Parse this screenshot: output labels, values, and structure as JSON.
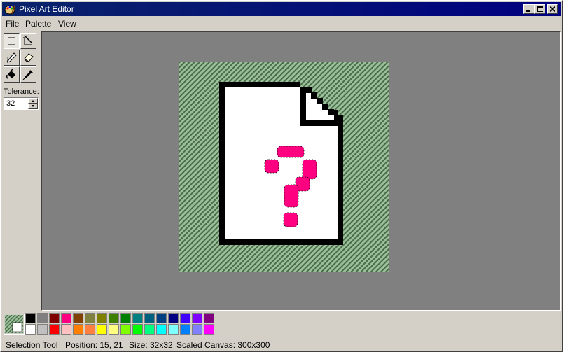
{
  "window": {
    "title": "Pixel Art Editor"
  },
  "menu": [
    "File",
    "Palette",
    "View"
  ],
  "tools": [
    {
      "name": "selection-tool",
      "icon": "selection-rect-icon",
      "active": true
    },
    {
      "name": "magic-wand-tool",
      "icon": "magic-wand-icon",
      "active": false
    },
    {
      "name": "pencil-tool",
      "icon": "pencil-icon",
      "active": false
    },
    {
      "name": "eraser-tool",
      "icon": "eraser-icon",
      "active": false
    },
    {
      "name": "fill-tool",
      "icon": "paint-bucket-icon",
      "active": false
    },
    {
      "name": "eyedropper-tool",
      "icon": "eyedropper-icon",
      "active": false
    }
  ],
  "tolerance": {
    "label": "Tolerance:",
    "value": "32"
  },
  "colors": {
    "accent": "#ff0080",
    "outline": "#000000",
    "background_checker": "#9ac09a",
    "workspace": "#808080",
    "palette_row1": [
      "#000000",
      "#808080",
      "#800000",
      "#ff0080",
      "#804000",
      "#808040",
      "#808000",
      "#408000",
      "#008000",
      "#008080",
      "#006080",
      "#004080",
      "#000080",
      "#4000ff",
      "#8000ff",
      "#800080"
    ],
    "palette_row2": [
      "#ffffff",
      "#c0c0c0",
      "#ff0000",
      "#ffc0c0",
      "#ff8000",
      "#ff8040",
      "#ffff00",
      "#ffff80",
      "#80ff00",
      "#00ff00",
      "#00ff80",
      "#00ffff",
      "#80ffff",
      "#0080ff",
      "#8080ff",
      "#ff00ff"
    ]
  },
  "status": {
    "tool": "Selection Tool",
    "position": "Position: 15, 21",
    "size": "Size: 32x32",
    "scaled": "Scaled Canvas: 300x300"
  }
}
